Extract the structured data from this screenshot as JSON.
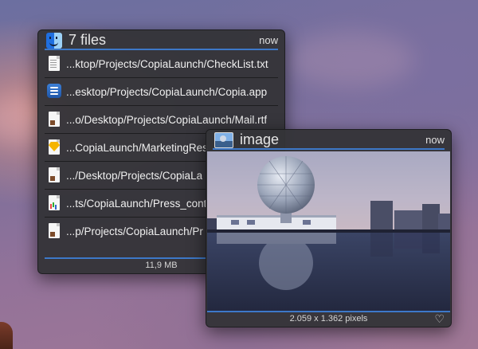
{
  "files_panel": {
    "title": "7 files",
    "time": "now",
    "icon": "finder-icon",
    "items": [
      {
        "path": "...ktop/Projects/CopiaLaunch/CheckList.txt",
        "icon": "text-file-icon"
      },
      {
        "path": "...esktop/Projects/CopiaLaunch/Copia.app",
        "icon": "app-icon"
      },
      {
        "path": "...o/Desktop/Projects/CopiaLaunch/Mail.rtf",
        "icon": "rtf-file-icon"
      },
      {
        "path": "...CopiaLaunch/MarketingRes",
        "icon": "sketch-file-icon"
      },
      {
        "path": ".../Desktop/Projects/CopiaLa",
        "icon": "rtf-file-icon"
      },
      {
        "path": "...ts/CopiaLaunch/Press_cont",
        "icon": "numbers-file-icon"
      },
      {
        "path": "...p/Projects/CopiaLaunch/Pr",
        "icon": "rtf-file-icon"
      }
    ],
    "footer": "11,9 MB"
  },
  "image_panel": {
    "title": "image",
    "time": "now",
    "icon": "image-icon",
    "footer": "2.059 x 1.362 pixels",
    "favorite_icon": "heart-icon"
  },
  "colors": {
    "panel_bg": "#343438",
    "accent": "#3d78c8"
  }
}
